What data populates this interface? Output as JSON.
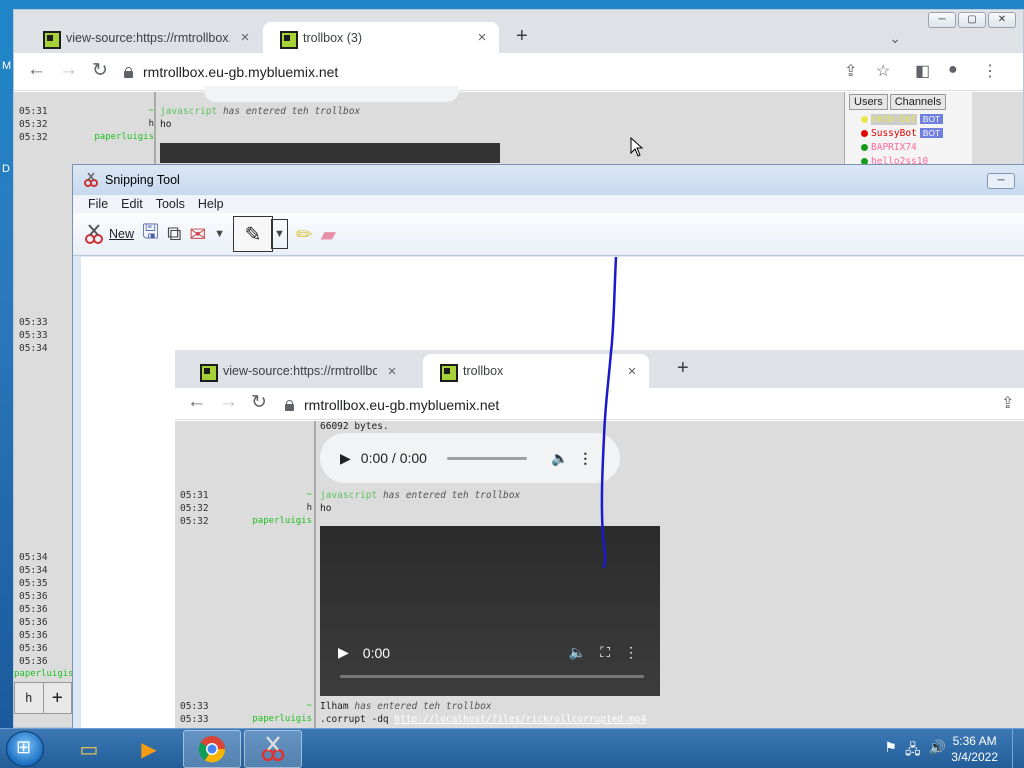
{
  "desktop": {
    "left_letters": [
      "M",
      "D"
    ]
  },
  "chrome": {
    "tabs": [
      {
        "label": "view-source:https://rmtrollbox.eu-gb.mybluemix.net",
        "close": "×"
      },
      {
        "label": "trollbox (3)",
        "close": "×"
      }
    ],
    "new_tab": "+",
    "tab_search": "⌄",
    "window_controls": [
      "─",
      "▢",
      "✕"
    ],
    "url": "rmtrollbox.eu-gb.mybluemix.net",
    "nav": {
      "back": "←",
      "forward": "→",
      "reload": "↻"
    },
    "toolbar_icons": {
      "share": "⇪",
      "bookmark": "☆",
      "sidepanel": "◧",
      "profile": "●",
      "menu": "⋮"
    }
  },
  "trollbox": {
    "times_top": [
      "05:31",
      "05:32",
      "05:32"
    ],
    "nicks_top": [
      "~",
      "h",
      "paperluigis"
    ],
    "msgs_top": [
      {
        "nick": "javascript",
        "text": "has entered teh trollbox"
      },
      {
        "text": "ho"
      }
    ],
    "times_mid": [
      "05:33",
      "05:33",
      "05:34"
    ],
    "times_bottom": [
      "05:34",
      "05:34",
      "05:35",
      "05:36",
      "05:36",
      "05:36",
      "05:36",
      "05:36",
      "05:36"
    ],
    "bottom_nick": "paperluigis",
    "input_buttons": [
      "h",
      "+"
    ],
    "side_tabs": [
      "Users",
      "Channels"
    ],
    "users": [
      {
        "name": "rmtb-bot",
        "badge": "BOT",
        "color": "#e8e84a"
      },
      {
        "name": "SussyBot",
        "badge": "BOT",
        "color": "#e00000"
      },
      {
        "name": "BAPRIX74",
        "badge": "",
        "color": "#1a9a1a"
      },
      {
        "name": "hello2ss10",
        "badge": "",
        "color": "#1a9a1a"
      }
    ]
  },
  "snipping_tool": {
    "title": "Snipping Tool",
    "menu": [
      "File",
      "Edit",
      "Tools",
      "Help"
    ],
    "new_label": "New",
    "min_ctrl": "─"
  },
  "captured": {
    "tabs": [
      {
        "label": "view-source:https://rmtrollbox.eu-gb.mybluemix.net",
        "close": "×"
      },
      {
        "label": "trollbox",
        "close": "×"
      }
    ],
    "new_tab": "+",
    "url": "rmtrollbox.eu-gb.mybluemix.net",
    "bytes_line": "66092 bytes.",
    "audio_time": "0:00 / 0:00",
    "times": [
      "05:31",
      "05:32",
      "05:32"
    ],
    "nicks": [
      "~",
      "h",
      "paperluigis"
    ],
    "msgs": [
      {
        "nick": "javascript",
        "text": "has entered teh trollbox"
      },
      {
        "text": "ho"
      }
    ],
    "video_time": "0:00",
    "times2": [
      "05:33",
      "05:33"
    ],
    "nicks2": [
      "~",
      "paperluigis"
    ],
    "msg_ilham": {
      "nick": "Ilham",
      "text": "has entered teh trollbox"
    },
    "cmd": ".corrupt -dq",
    "cmd_link": "http://localhost/files/rickrollcorrupted.mp4"
  },
  "taskbar": {
    "time": "5:36 AM",
    "date": "3/4/2022",
    "tray_icons": [
      "flag-icon",
      "network-icon",
      "volume-icon"
    ]
  }
}
